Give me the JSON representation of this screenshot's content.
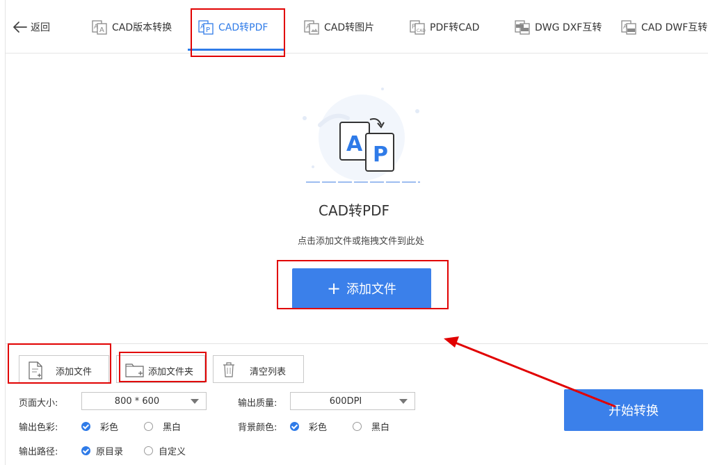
{
  "nav": {
    "back_label": "返回",
    "tabs": [
      {
        "label": "CAD版本转换",
        "icon": "cad-version-icon"
      },
      {
        "label": "CAD转PDF",
        "icon": "cad-to-pdf-icon",
        "active": true
      },
      {
        "label": "CAD转图片",
        "icon": "cad-to-image-icon"
      },
      {
        "label": "PDF转CAD",
        "icon": "pdf-to-cad-icon"
      },
      {
        "label": "DWG DXF互转",
        "icon": "dwg-dxf-icon"
      },
      {
        "label": "CAD DWF互转",
        "icon": "cad-dwf-icon"
      }
    ]
  },
  "hero": {
    "title": "CAD转PDF",
    "subtitle": "点击添加文件或拖拽文件到此处",
    "add_button": "添加文件",
    "illustration_letters": [
      "A",
      "P"
    ]
  },
  "toolbar": {
    "add_file": "添加文件",
    "add_folder": "添加文件夹",
    "clear_list": "清空列表"
  },
  "settings": {
    "page_size_label": "页面大小:",
    "page_size_value": "800 * 600",
    "quality_label": "输出质量:",
    "quality_value": "600DPI",
    "color_label": "输出色彩:",
    "color_options": [
      "彩色",
      "黑白"
    ],
    "color_selected": "彩色",
    "bg_label": "背景颜色:",
    "bg_options": [
      "彩色",
      "黑白"
    ],
    "bg_selected": "彩色",
    "path_label": "输出路径:",
    "path_options": [
      "原目录",
      "自定义"
    ],
    "path_selected": "原目录"
  },
  "start_button": "开始转换",
  "colors": {
    "accent": "#3b80ea",
    "active_tab": "#2f7be8",
    "annotation_red": "#e10000"
  }
}
